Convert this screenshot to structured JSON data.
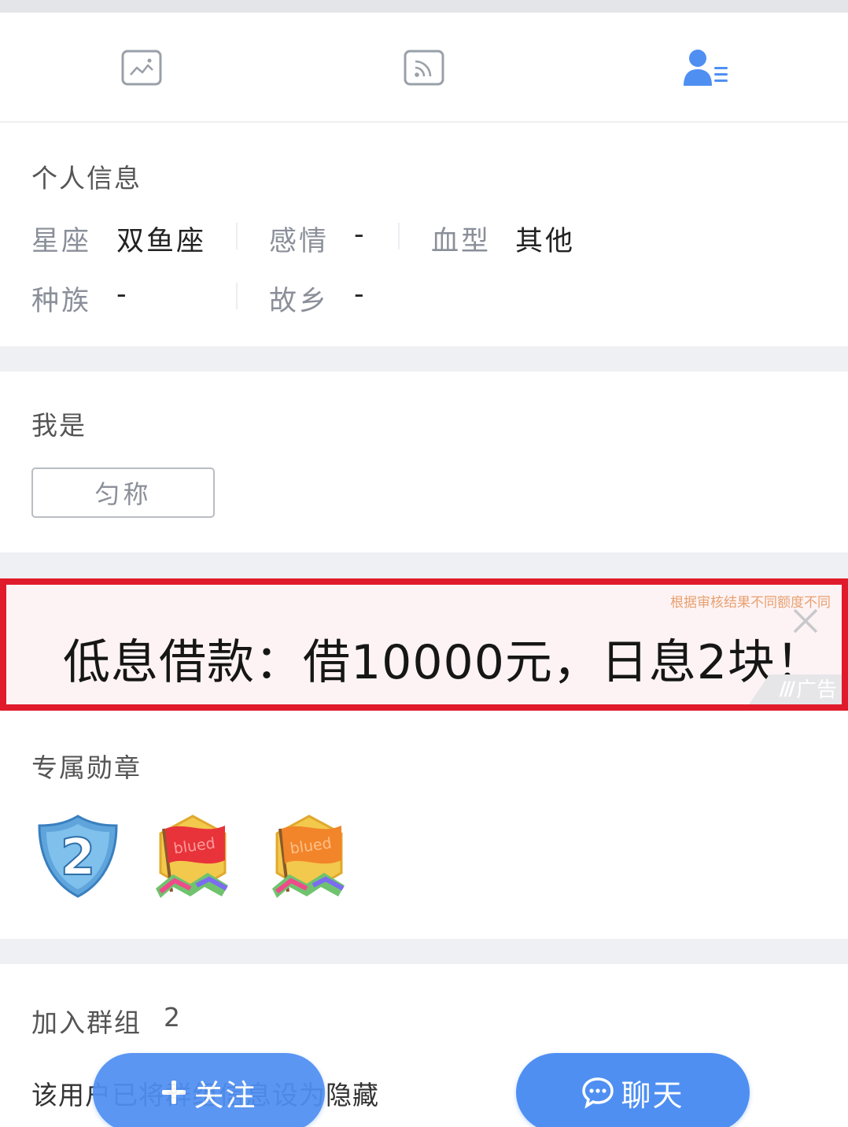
{
  "tabs": [
    {
      "icon": "photo-album-icon",
      "active": false
    },
    {
      "icon": "feed-rss-icon",
      "active": false
    },
    {
      "icon": "user-profile-icon",
      "active": true
    }
  ],
  "colors": {
    "accent": "#4f8ff2",
    "ad_border": "#e01b2b",
    "background_gap": "#eff0f3"
  },
  "personal_info": {
    "title": "个人信息",
    "fields": [
      {
        "label": "星座",
        "value": "双鱼座"
      },
      {
        "label": "感情",
        "value": "-"
      },
      {
        "label": "血型",
        "value": "其他"
      },
      {
        "label": "种族",
        "value": "-"
      },
      {
        "label": "故乡",
        "value": "-"
      }
    ]
  },
  "i_am": {
    "title": "我是",
    "tag": "匀称"
  },
  "ad": {
    "note": "根据审核结果不同额度不同",
    "headline": "低息借款：借10000元，日息2块！",
    "tag": "广告"
  },
  "badges": {
    "title": "专属勋章",
    "items": [
      {
        "icon": "level-2-shield-badge-icon",
        "number": "2"
      },
      {
        "icon": "blued-red-flag-badge-icon",
        "flag_text": "blued"
      },
      {
        "icon": "blued-orange-flag-badge-icon",
        "flag_text": "blued"
      }
    ]
  },
  "groups": {
    "label": "加入群组",
    "count": "2",
    "note": "该用户已将群组信息设为隐藏"
  },
  "actions": {
    "follow": "关注",
    "chat": "聊天"
  }
}
